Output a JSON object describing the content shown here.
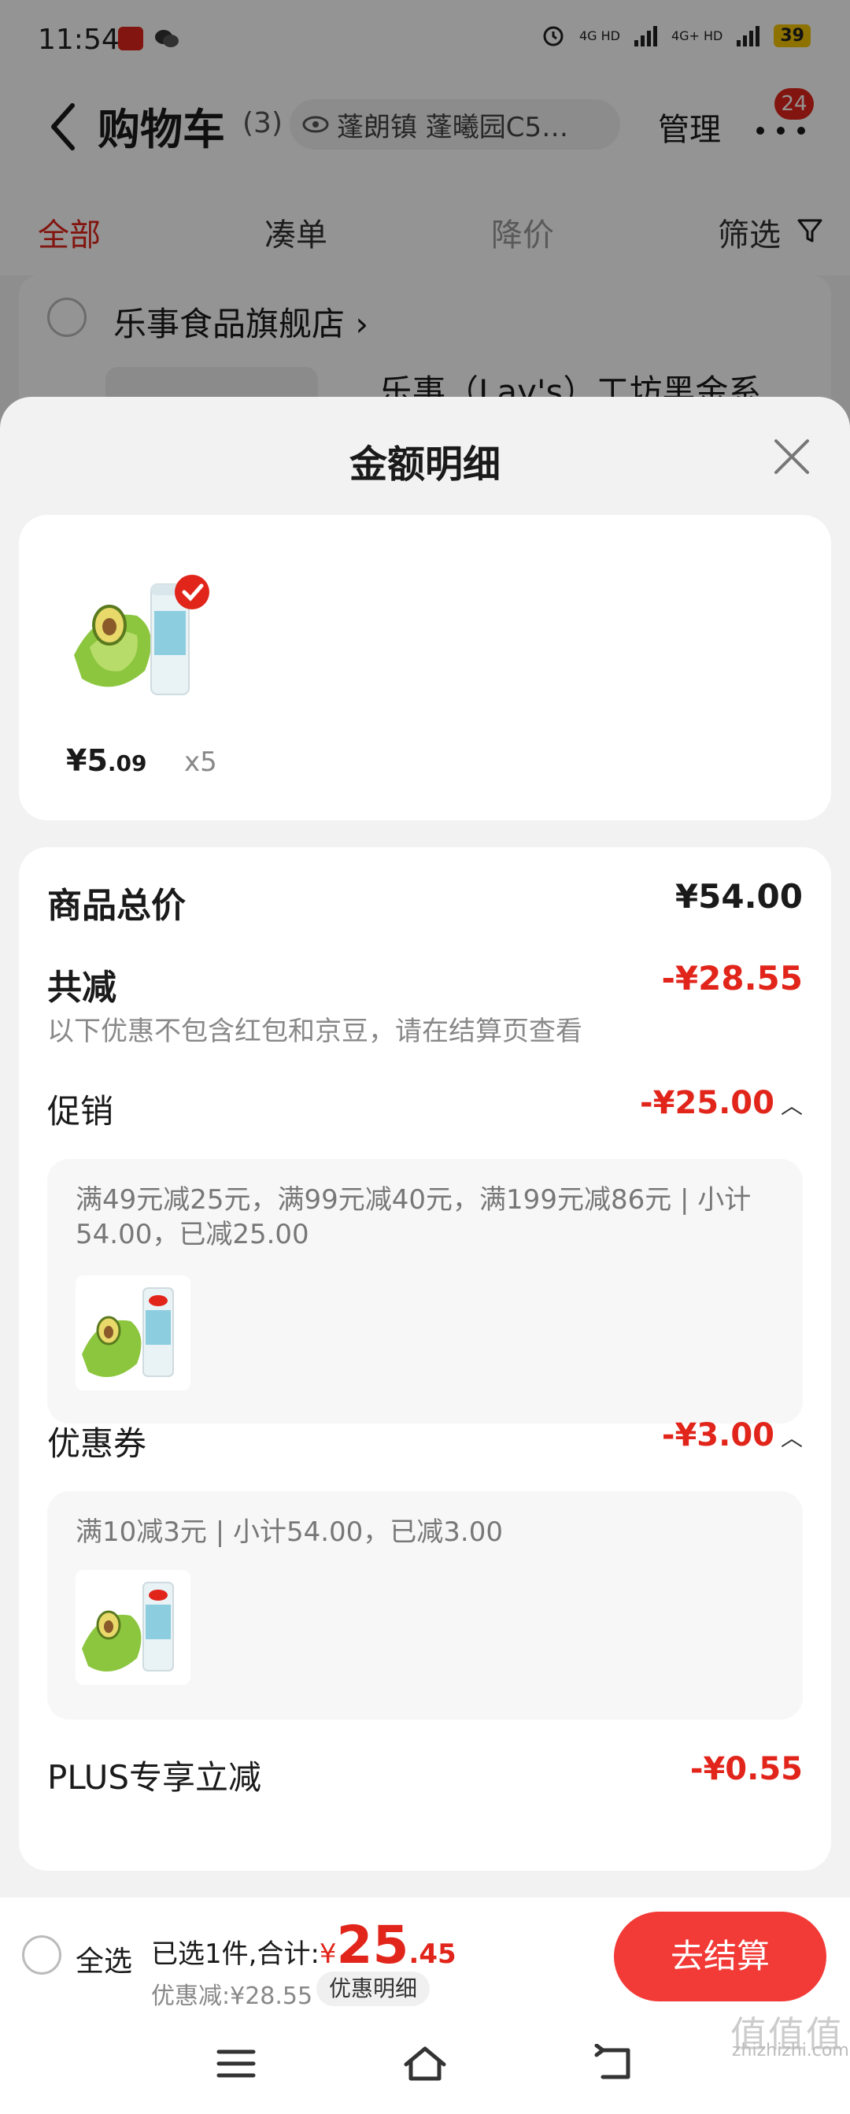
{
  "status_bar": {
    "time": "11:54",
    "network1": "4G HD",
    "network2": "4G+ HD",
    "battery": "39"
  },
  "header": {
    "title": "购物车",
    "count": "(3)",
    "address": "蓬朗镇 蓬曦园C5…",
    "manage": "管理",
    "badge": "24"
  },
  "tabs": [
    {
      "label": "全部"
    },
    {
      "label": "凑单"
    },
    {
      "label": "降价"
    },
    {
      "label": "筛选"
    }
  ],
  "store": {
    "name": "乐事食品旗舰店 ›",
    "product_name": "乐事（Lay's）工坊黑金系"
  },
  "sheet": {
    "title": "金额明细",
    "item": {
      "price_int": "¥5",
      "price_dec": ".09",
      "qty": "x5"
    },
    "goods_total_label": "商品总价",
    "goods_total_value": "¥54.00",
    "reduce_label": "共减",
    "reduce_value": "-¥28.55",
    "reduce_note": "以下优惠不包含红包和京豆，请在结算页查看",
    "promo_label": "促销",
    "promo_value": "-¥25.00",
    "promo_text": "满49元减25元，满99元减40元，满199元减86元 | 小计54.00，已减25.00",
    "coupon_label": "优惠券",
    "coupon_value": "-¥3.00",
    "coupon_text": "满10减3元 | 小计54.00，已减3.00",
    "plus_label": "PLUS专享立减",
    "plus_value": "-¥0.55"
  },
  "bottom_bar": {
    "select_all": "全选",
    "selected_text": "已选1件,合计:",
    "total_currency": "¥",
    "total_int": "25",
    "total_dec": ".45",
    "discount_text": "优惠减:¥28.55",
    "detail_chip": "优惠明细",
    "checkout": "去结算"
  },
  "watermark": {
    "big": "值值值",
    "small": "zhizhizhi.com"
  },
  "colors": {
    "accent": "#e1251b",
    "checkout": "#f23a37"
  }
}
